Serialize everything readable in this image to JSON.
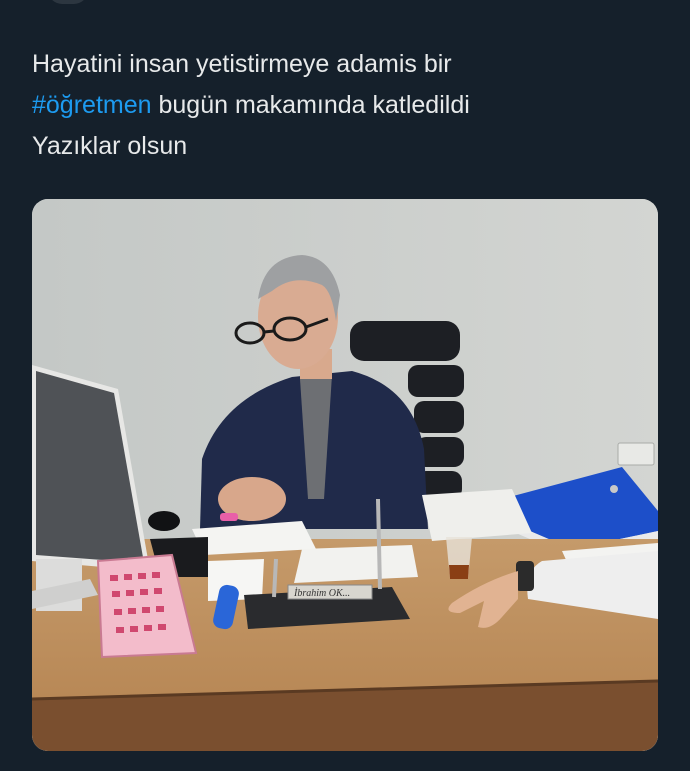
{
  "tweet": {
    "text_line1": "Hayatini insan yetistirmeye adamis bir",
    "hashtag": "#öğretmen",
    "text_line2_rest": " bugün makamında katledildi",
    "text_line3": "Yazıklar olsun"
  },
  "media": {
    "nameplate_text": "İbrahim OK...",
    "icons": [
      "desk-calendar",
      "computer-monitor",
      "office-chair",
      "blue-binder"
    ]
  },
  "colors": {
    "background": "#15202b",
    "text": "#e7e9ea",
    "hashtag": "#1d9bf0"
  }
}
